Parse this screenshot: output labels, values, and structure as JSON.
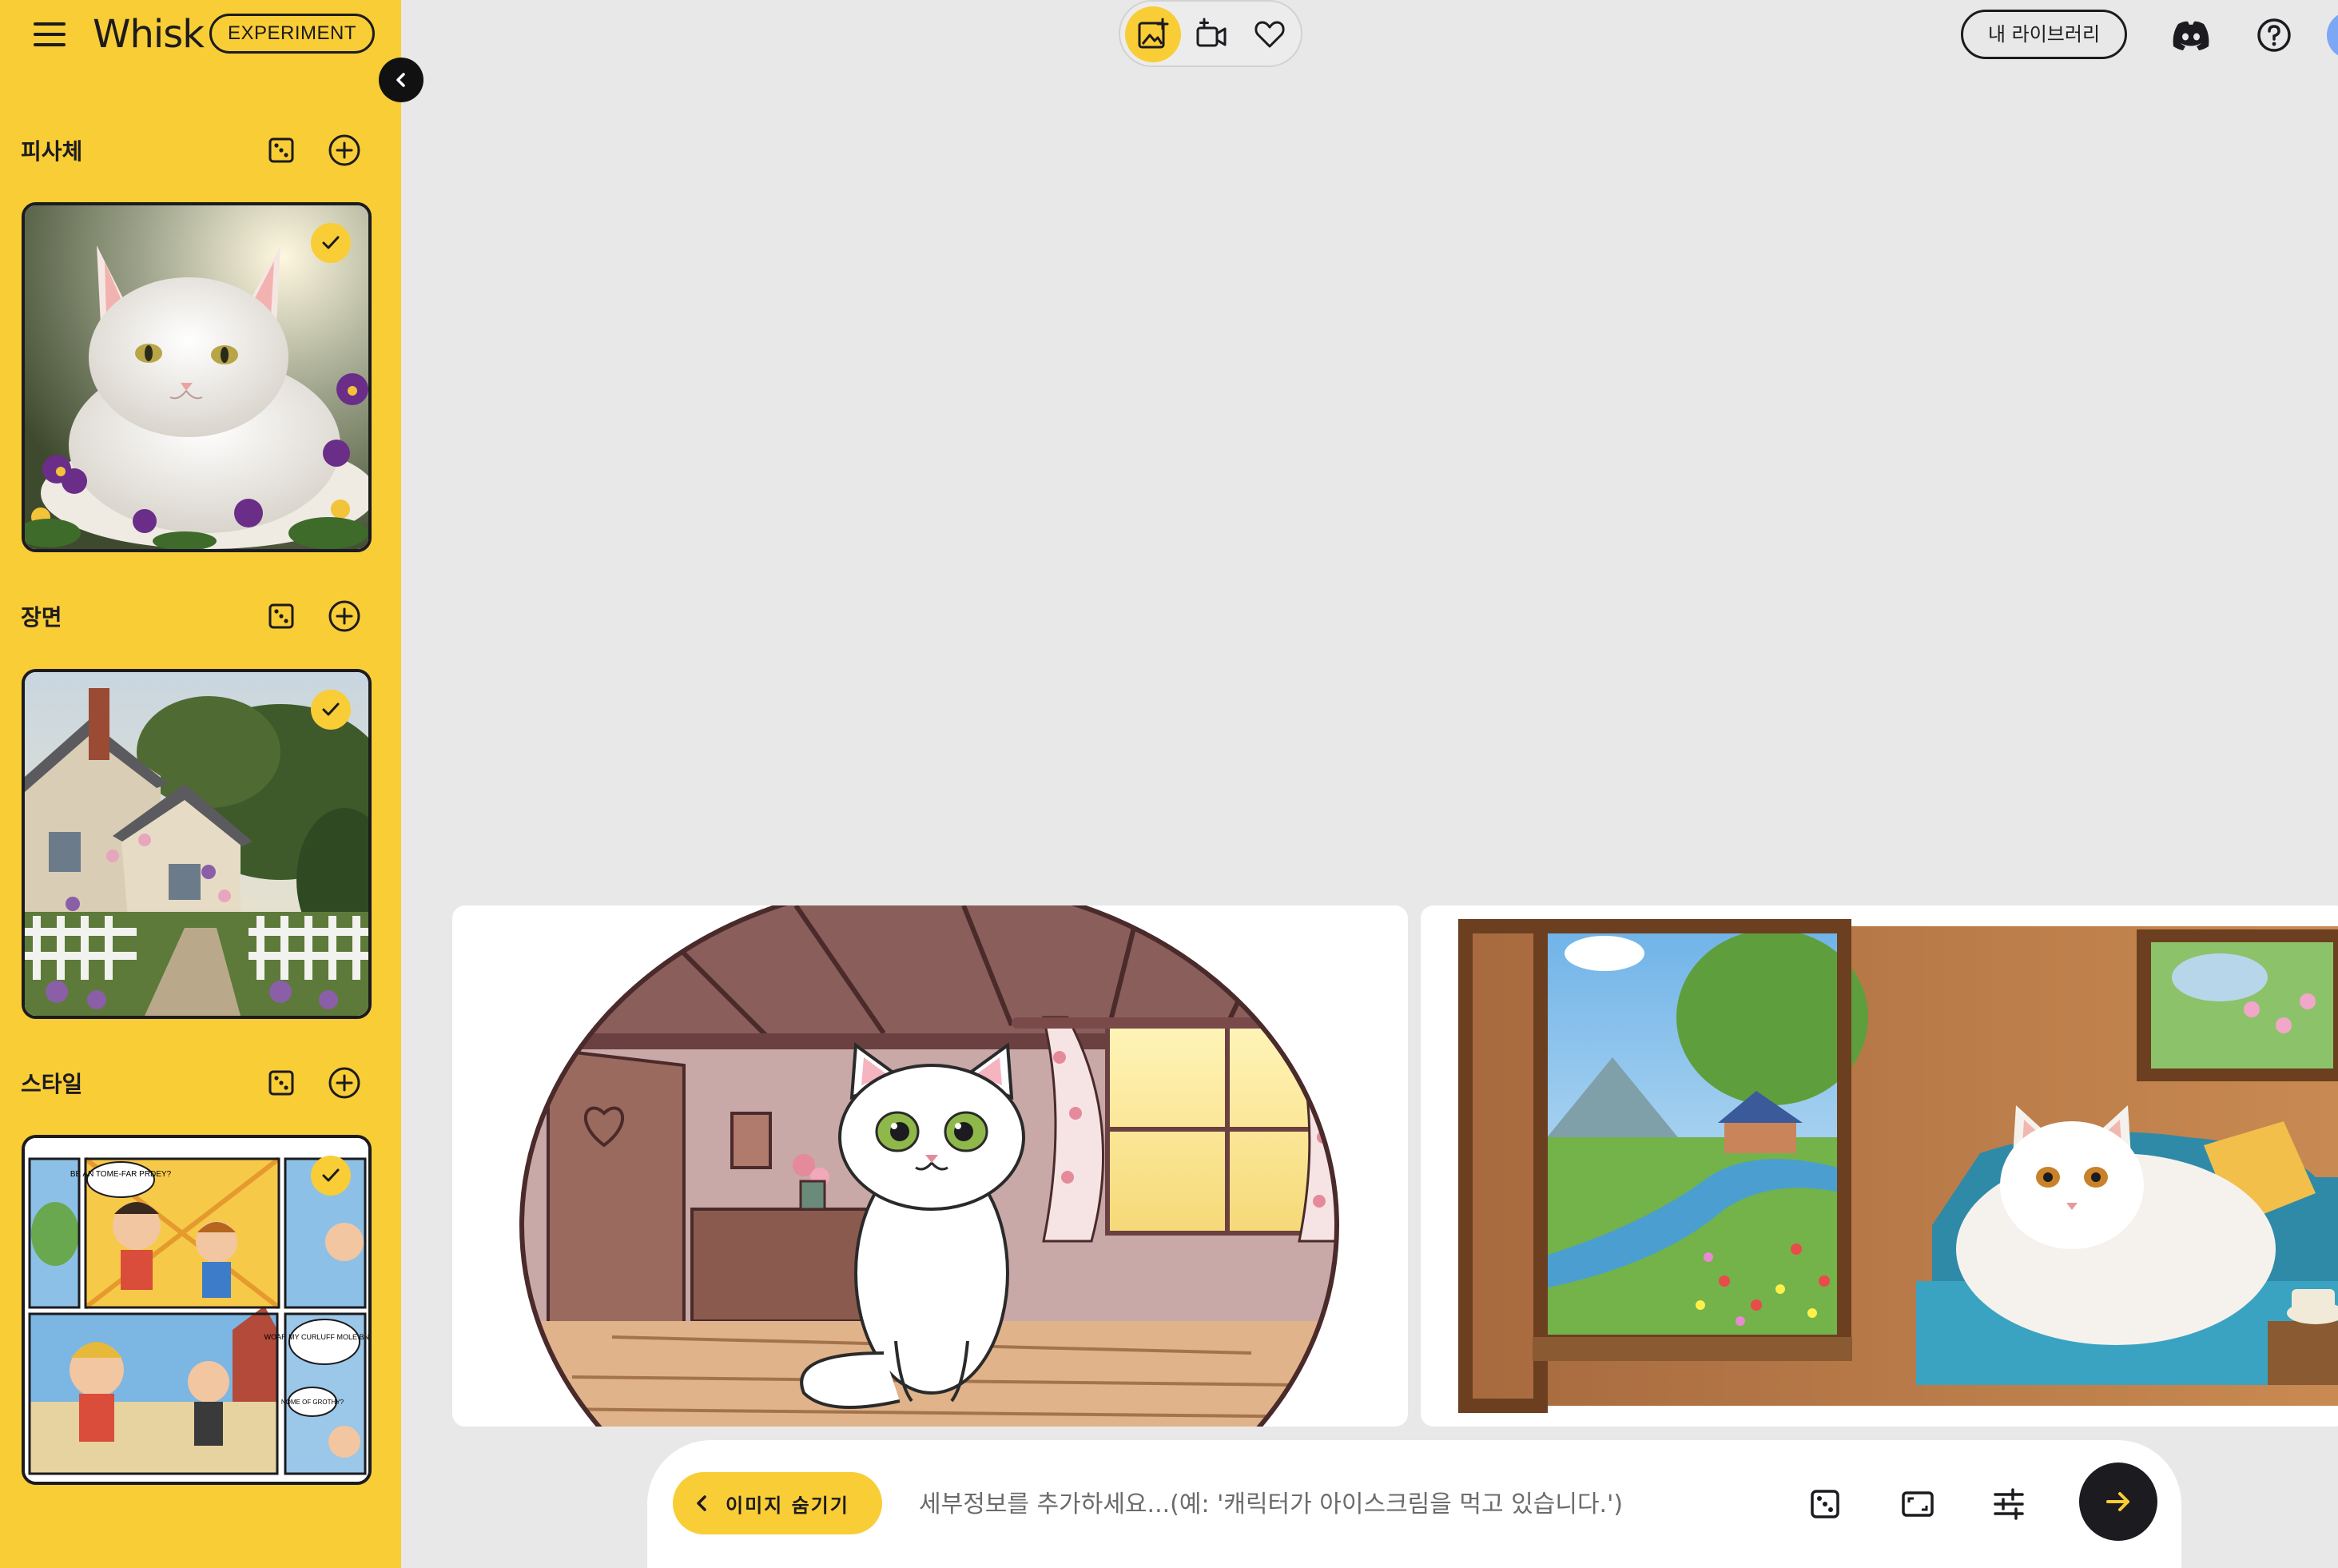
{
  "app": {
    "brand": "Whisk",
    "badge": "EXPERIMENT"
  },
  "sidebar": {
    "sections": [
      {
        "title": "피사체",
        "image": "white cat sitting among purple pansies",
        "selected": true
      },
      {
        "title": "장면",
        "image": "cottage with garden and picket fence",
        "selected": true
      },
      {
        "title": "스타일",
        "image": "colorful comic book panels",
        "selected": true
      }
    ],
    "comic_bubbles": [
      "BE AN TOME-FAR PRDEY?",
      "WOAR MY CURLUFF MOLE BNUTY.",
      "NOME OF GROTHY?"
    ]
  },
  "topbar": {
    "modes": [
      {
        "icon": "add-image-icon",
        "active": true
      },
      {
        "icon": "video-icon",
        "active": false
      },
      {
        "icon": "heart-icon",
        "active": false
      }
    ],
    "library_label": "내 라이브러리"
  },
  "results": [
    {
      "description": "cartoon white cat sitting in a wooden room"
    },
    {
      "description": "fluffy white cat lying on a sofa by an open window"
    }
  ],
  "prompt": {
    "hide_images_label": "이미지 숨기기",
    "placeholder": "세부정보를 추가하세요...(예: '캐릭터가 아이스크림을 먹고 있습니다.')"
  },
  "colors": {
    "accent": "#f9cd35",
    "dark": "#1c1b1f",
    "canvas": "#e8e8e8"
  }
}
